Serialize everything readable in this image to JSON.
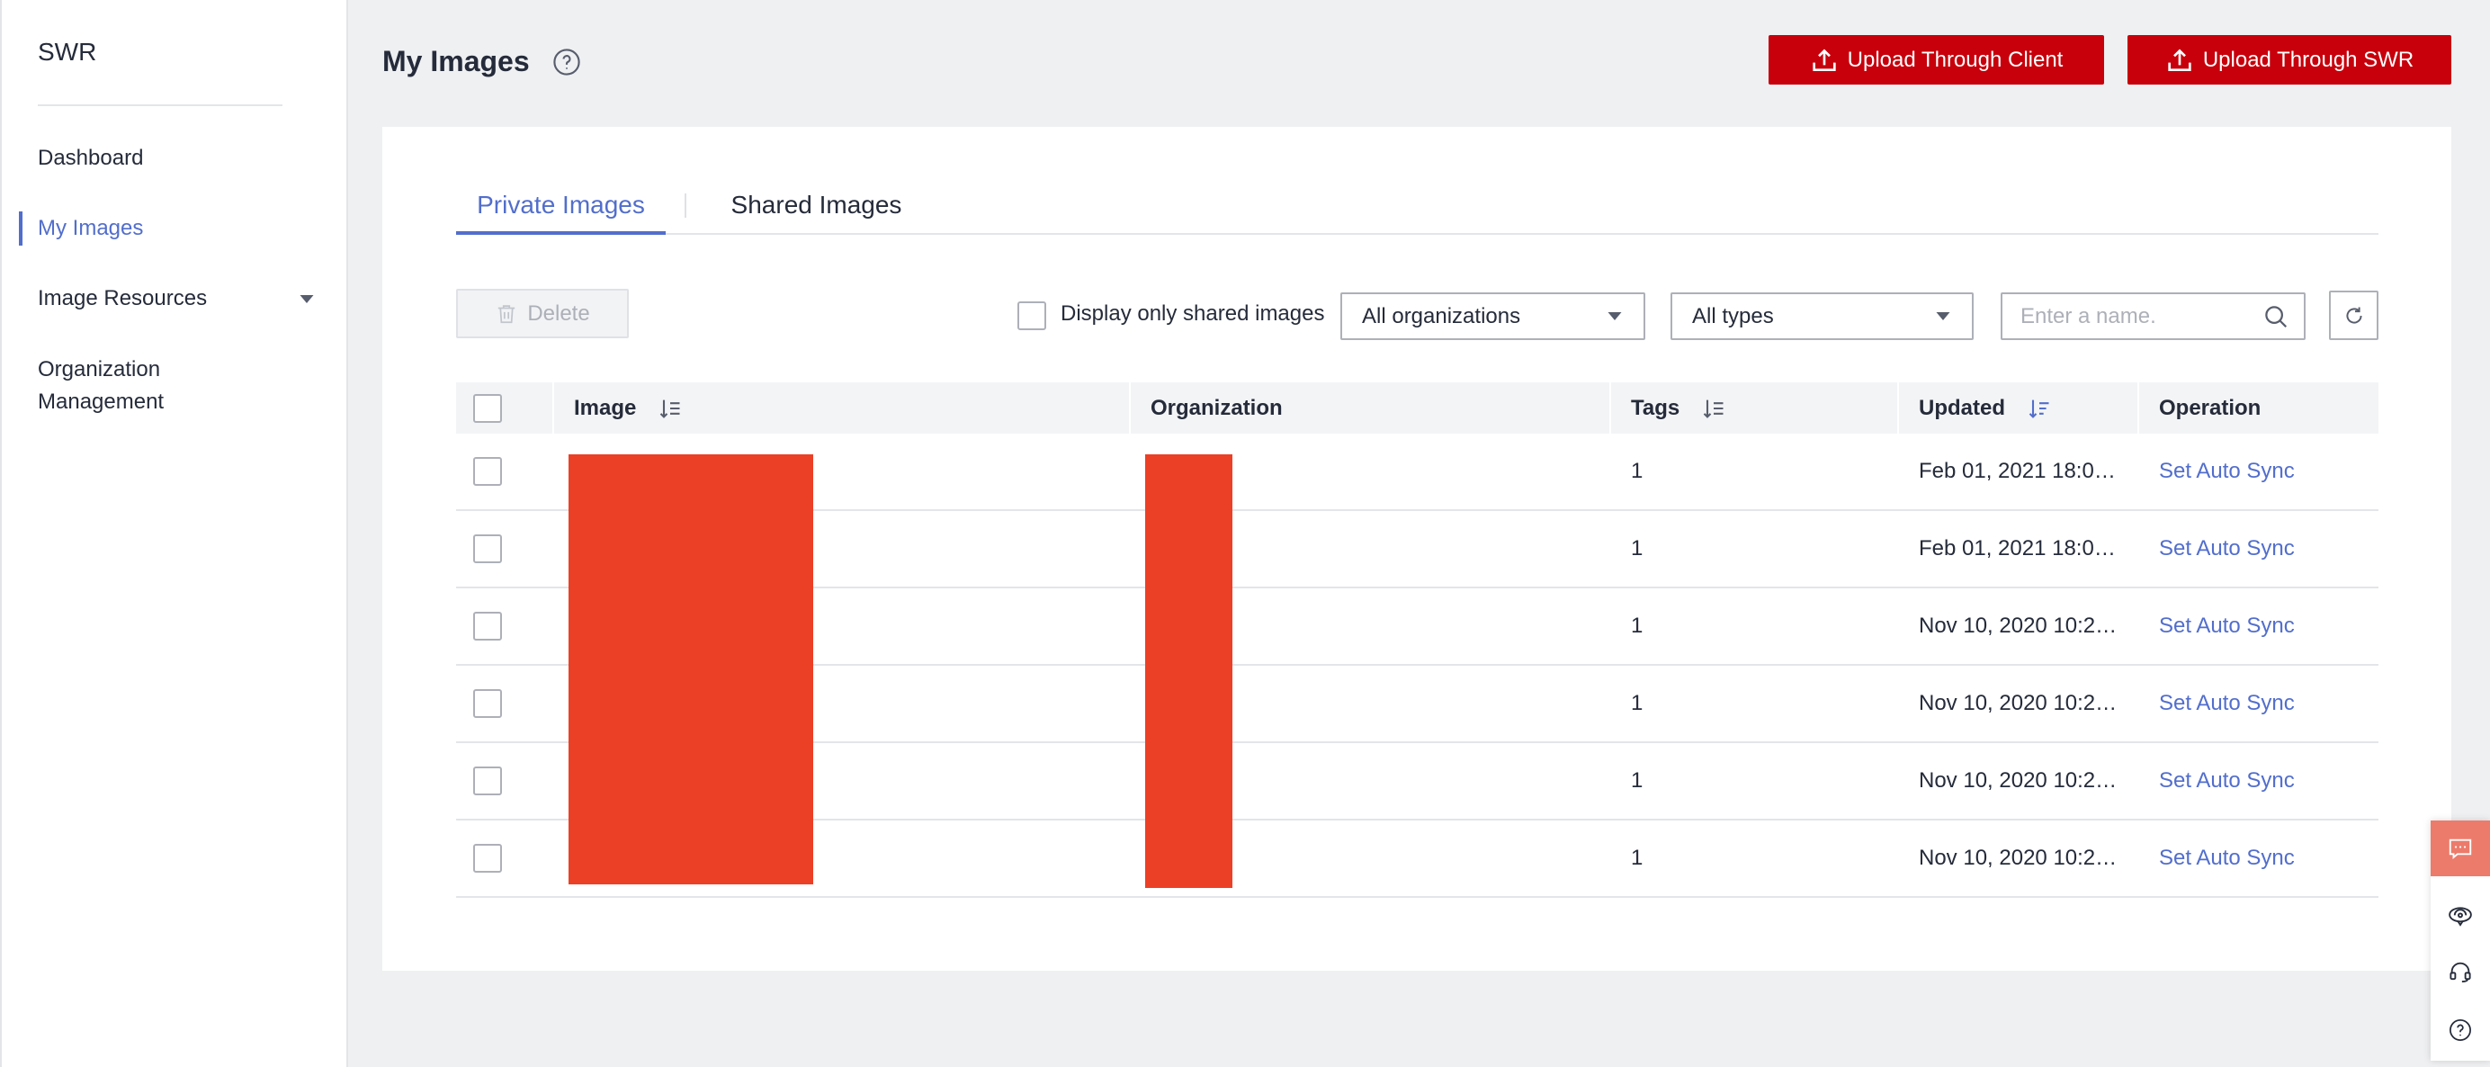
{
  "theme": {
    "accent": "#526ecc",
    "brand_red": "#c7000b",
    "redaction": "#ec4026",
    "float_accent": "#ec7b6b"
  },
  "sidebar": {
    "title": "SWR",
    "items": [
      {
        "label": "Dashboard",
        "active": false
      },
      {
        "label": "My Images",
        "active": true
      },
      {
        "label": "Image Resources",
        "active": false,
        "expand_icon": "caret-down-icon"
      },
      {
        "label": "Organization Management",
        "active": false
      }
    ]
  },
  "header": {
    "title": "My Images",
    "help_icon": "help-circle-icon",
    "actions": [
      {
        "label": "Upload Through Client",
        "icon": "upload-icon"
      },
      {
        "label": "Upload Through SWR",
        "icon": "upload-icon"
      }
    ]
  },
  "tabs": [
    {
      "label": "Private Images",
      "active": true
    },
    {
      "label": "Shared Images",
      "active": false
    }
  ],
  "toolbar": {
    "delete_label": "Delete",
    "delete_icon": "trash-icon",
    "delete_disabled": true,
    "shared_only_label": "Display only shared images",
    "shared_only_checked": false,
    "organization_filter": "All organizations",
    "type_filter": "All types",
    "search_placeholder": "Enter a name.",
    "search_icon": "search-icon",
    "refresh_icon": "refresh-icon"
  },
  "table": {
    "columns": [
      {
        "label": "Image",
        "sortable": true,
        "sorted": false
      },
      {
        "label": "Organization",
        "sortable": false
      },
      {
        "label": "Tags",
        "sortable": true,
        "sorted": false
      },
      {
        "label": "Updated",
        "sortable": true,
        "sorted": true
      },
      {
        "label": "Operation",
        "sortable": false
      }
    ],
    "rows": [
      {
        "tags": "1",
        "updated": "Feb 01, 2021 18:0…",
        "operation": "Set Auto Sync",
        "checked": false
      },
      {
        "tags": "1",
        "updated": "Feb 01, 2021 18:0…",
        "operation": "Set Auto Sync",
        "checked": false
      },
      {
        "tags": "1",
        "updated": "Nov 10, 2020 10:2…",
        "operation": "Set Auto Sync",
        "checked": false
      },
      {
        "tags": "1",
        "updated": "Nov 10, 2020 10:2…",
        "operation": "Set Auto Sync",
        "checked": false
      },
      {
        "tags": "1",
        "updated": "Nov 10, 2020 10:2…",
        "operation": "Set Auto Sync",
        "checked": false
      },
      {
        "tags": "1",
        "updated": "Nov 10, 2020 10:2…",
        "operation": "Set Auto Sync",
        "checked": false
      }
    ]
  },
  "floating_tools": [
    {
      "icon": "chat-icon"
    },
    {
      "icon": "feedback-icon"
    },
    {
      "icon": "headset-icon"
    },
    {
      "icon": "help-circle-icon"
    }
  ]
}
